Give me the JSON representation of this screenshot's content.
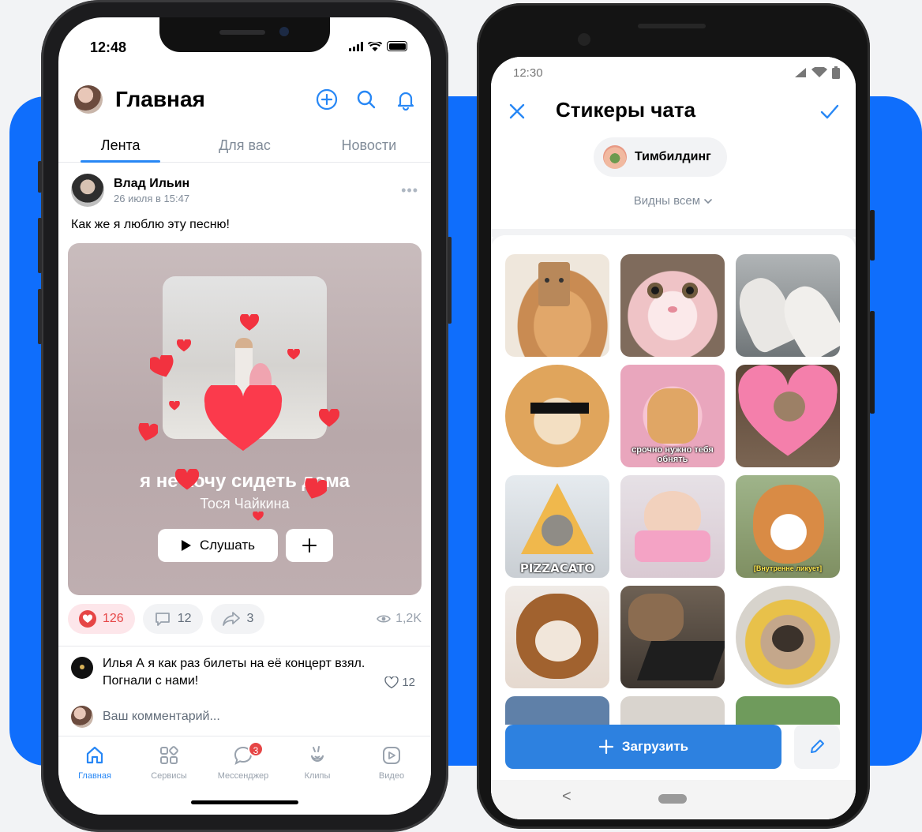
{
  "colors": {
    "accent": "#2787f5",
    "background_blue": "#0f6efc",
    "like_red": "#e64646",
    "upload_button": "#2d81e0"
  },
  "iphone": {
    "status": {
      "time": "12:48"
    },
    "header": {
      "title": "Главная",
      "icons": [
        "add-circle-icon",
        "search-icon",
        "bell-icon"
      ]
    },
    "tabs": [
      "Лента",
      "Для вас",
      "Новости"
    ],
    "active_tab": "Лента",
    "post": {
      "author": "Влад Ильин",
      "date": "26 июля в 15:47",
      "text": "Как же я люблю эту песню!",
      "music": {
        "title": "я не хочу сидеть дома",
        "artist": "Тося Чайкина",
        "listen_label": "Слушать",
        "add_label": "+"
      },
      "likes": "126",
      "comments": "12",
      "shares": "3",
      "views": "1,2K"
    },
    "comment": {
      "author": "Илья А",
      "text": "я как раз билеты на её концерт взял. Погнали с нами!",
      "likes": "12"
    },
    "comment_placeholder": "Ваш комментарий...",
    "tabbar": [
      {
        "label": "Главная",
        "icon": "home-icon",
        "active": true
      },
      {
        "label": "Сервисы",
        "icon": "services-icon",
        "active": false
      },
      {
        "label": "Мессенджер",
        "icon": "messenger-icon",
        "active": false,
        "badge": "3"
      },
      {
        "label": "Клипы",
        "icon": "clips-icon",
        "active": false
      },
      {
        "label": "Видео",
        "icon": "video-icon",
        "active": false
      }
    ]
  },
  "android": {
    "status": {
      "time": "12:30"
    },
    "header": {
      "title": "Стикеры чата",
      "close_icon": "close-icon",
      "confirm_icon": "check-icon"
    },
    "pack": {
      "name": "Тимбилдинг"
    },
    "visibility": "Видны всем",
    "stickers": [
      {
        "name": "cat-paper-bag",
        "caption": ""
      },
      {
        "name": "pink-cat-face",
        "caption": ""
      },
      {
        "name": "borzoi-dogs",
        "caption": ""
      },
      {
        "name": "doge-sunglasses",
        "caption": ""
      },
      {
        "name": "cat-hearts",
        "caption": "срочно нужно тебя обнять"
      },
      {
        "name": "cat-heart-hole",
        "caption": ""
      },
      {
        "name": "cat-pizza",
        "caption": "PIZZACATO"
      },
      {
        "name": "chihuahua-pink",
        "caption": ""
      },
      {
        "name": "corgi-puppy",
        "caption": "[Внутренне ликует]"
      },
      {
        "name": "kitten-bear-hat",
        "caption": ""
      },
      {
        "name": "capybara-laptop",
        "caption": ""
      },
      {
        "name": "pug-yellow-hat",
        "caption": ""
      }
    ],
    "upload_label": "Загрузить",
    "nav": {
      "back": "<"
    }
  }
}
